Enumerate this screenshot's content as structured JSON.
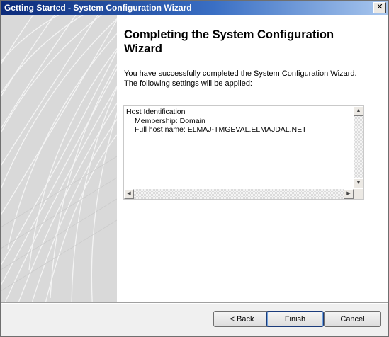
{
  "window": {
    "title": "Getting Started - System Configuration Wizard",
    "close_glyph": "✕"
  },
  "page": {
    "heading": "Completing the System Configuration Wizard",
    "description": "You have successfully completed the System Configuration Wizard. The following settings will be applied:"
  },
  "summary": {
    "section": "Host Identification",
    "lines": [
      "Membership: Domain",
      "Full host name: ELMAJ-TMGEVAL.ELMAJDAL.NET"
    ]
  },
  "scrollbars": {
    "up": "▲",
    "down": "▼",
    "left": "◀",
    "right": "▶"
  },
  "buttons": {
    "back": "< Back",
    "finish": "Finish",
    "cancel": "Cancel"
  }
}
